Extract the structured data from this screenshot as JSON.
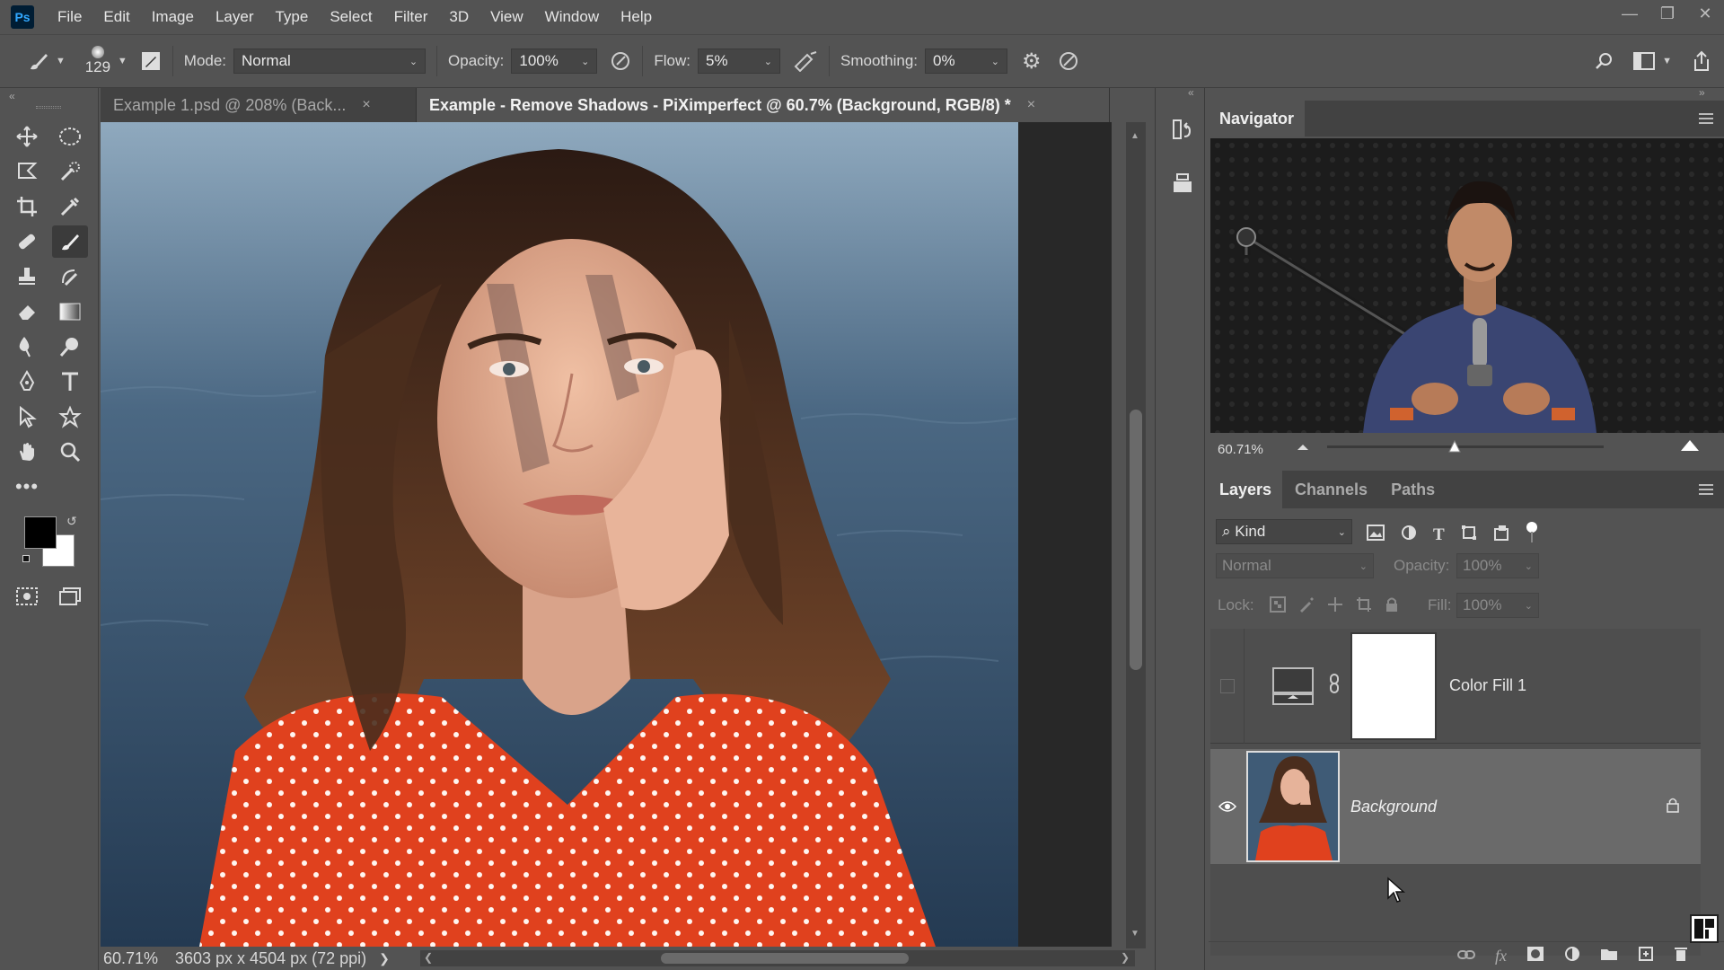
{
  "app": {
    "logo": "Ps"
  },
  "menu": [
    "File",
    "Edit",
    "Image",
    "Layer",
    "Type",
    "Select",
    "Filter",
    "3D",
    "View",
    "Window",
    "Help"
  ],
  "options": {
    "brush_size": "129",
    "mode_label": "Mode:",
    "mode_value": "Normal",
    "opacity_label": "Opacity:",
    "opacity_value": "100%",
    "flow_label": "Flow:",
    "flow_value": "5%",
    "smoothing_label": "Smoothing:",
    "smoothing_value": "0%"
  },
  "tabs": [
    {
      "label": "Example 1.psd @ 208% (Back...",
      "close": "×"
    },
    {
      "label": "Example - Remove Shadows - PiXimperfect @ 60.7% (Background, RGB/8) *",
      "close": "×"
    }
  ],
  "status": {
    "zoom": "60.71%",
    "doc_info": "3603 px x 4504 px (72 ppi)"
  },
  "navigator": {
    "title": "Navigator",
    "zoom": "60.71%",
    "zoom_slider_fraction": 0.46
  },
  "layers_panel": {
    "tabs": [
      "Layers",
      "Channels",
      "Paths"
    ],
    "filter_kind": "Kind",
    "blend_mode": "Normal",
    "opacity_label": "Opacity:",
    "opacity_value": "100%",
    "lock_label": "Lock:",
    "fill_label": "Fill:",
    "fill_value": "100%",
    "layers": [
      {
        "name": "Color Fill 1",
        "visible": false
      },
      {
        "name": "Background",
        "visible": true,
        "locked": true
      }
    ]
  },
  "colors": {
    "foreground": "#000000",
    "background": "#ffffff",
    "ui_bg": "#535353",
    "accent": "#31a8ff"
  }
}
